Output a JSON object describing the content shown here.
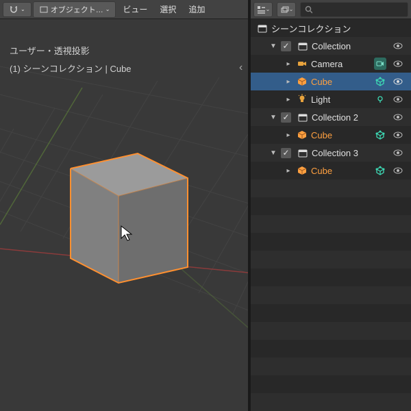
{
  "viewport": {
    "header": {
      "snap_label": "",
      "mode_label": "オブジェクト…",
      "view_label": "ビュー",
      "select_label": "選択",
      "add_label": "追加"
    },
    "info": {
      "projection": "ユーザー・透視投影",
      "context": "(1) シーンコレクション | Cube"
    }
  },
  "outliner": {
    "header": {
      "search_placeholder": ""
    },
    "root": "シーンコレクション",
    "collection1": "Collection",
    "camera": "Camera",
    "cube": "Cube",
    "light": "Light",
    "collection2": "Collection 2",
    "cube2": "Cube",
    "collection3": "Collection 3",
    "cube3": "Cube"
  }
}
